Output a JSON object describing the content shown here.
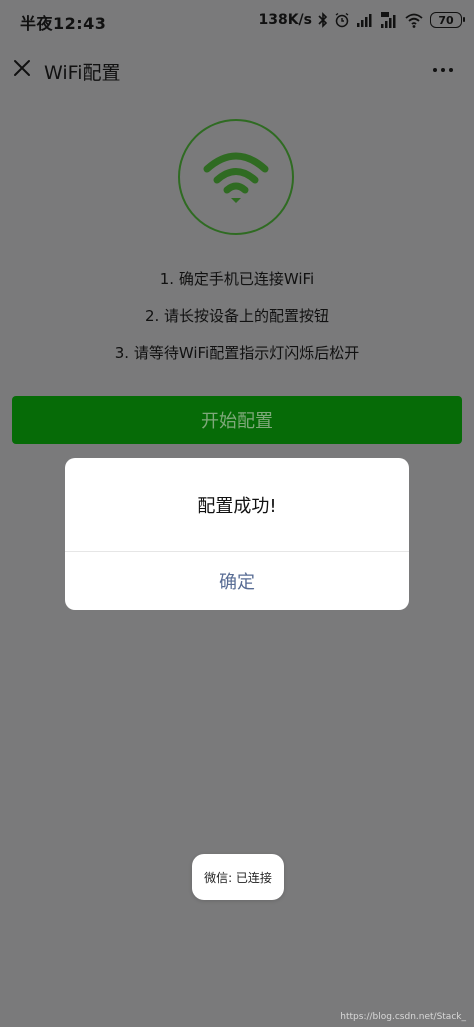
{
  "status_bar": {
    "time": "半夜12:43",
    "network_speed": "138K/s",
    "battery_level": "70",
    "icons": [
      "bluetooth-icon",
      "alarm-icon",
      "signal-icon",
      "signal-hd-icon",
      "wifi-icon",
      "battery-icon"
    ]
  },
  "navbar": {
    "title": "WiFi配置",
    "close_icon": "close-icon",
    "more_icon": "more-icon"
  },
  "main": {
    "wifi_icon": "wifi-icon",
    "steps": [
      "1. 确定手机已连接WiFi",
      "2. 请长按设备上的配置按钮",
      "3. 请等待WiFi配置指示灯闪烁后松开"
    ],
    "start_button_label": "开始配置"
  },
  "dialog": {
    "message": "配置成功!",
    "confirm_label": "确定"
  },
  "toast": {
    "text": "微信: 已连接"
  },
  "watermark": {
    "text": "https://blog.csdn.net/Stack_"
  },
  "colors": {
    "overlay_bg": "#7a7a7b",
    "accent_green": "#066b07",
    "wifi_green": "#2f6b22",
    "confirm_text": "#586c94"
  }
}
